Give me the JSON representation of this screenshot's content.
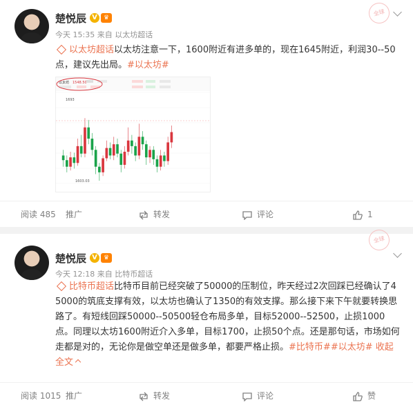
{
  "posts": [
    {
      "username": "楚悦辰",
      "meta": "今天 15:35 来自 以太坊超话",
      "stamp": "全球",
      "topic_tag": "以太坊超话",
      "text": "以太坊注意一下，1600附近有进多单的，现在1645附近，利润30--50点，建议先出局。",
      "hashtags": [
        "#以太坊#"
      ],
      "chart": {
        "header": {
          "symbol": "以太坊",
          "price": "1548.50"
        },
        "high_label": "1693",
        "low_label": "1603.03"
      },
      "actions": {
        "read": "阅读 485",
        "promote": "推广",
        "repost": "转发",
        "comment": "评论",
        "like": "1"
      }
    },
    {
      "username": "楚悦辰",
      "meta": "今天 12:18 来自 比特币超话",
      "stamp": "全球",
      "topic_tag": "比特币超话",
      "text": "比特币目前已经突破了50000的压制位，昨天经过2次回踩已经确认了45000的筑底支撑有效，以太坊也确认了1350的有效支撑。那么接下来下午就要转换思路了。有短线回踩50000--50500轻仓布局多单，目标52000--52500，止损1000点。同理以太坊1600附近介入多单，目标1700，止损50个点。还是那句话，市场如何走都是对的，无论你是做空单还是做多单，都要严格止损。",
      "hashtags": [
        "#比特币#",
        "#以太坊#"
      ],
      "collapse": "收起全文",
      "actions": {
        "read": "阅读 1015",
        "promote": "推广",
        "repost": "转发",
        "comment": "评论",
        "like": "赞"
      }
    }
  ],
  "chart_data": {
    "type": "candlestick",
    "candles": [
      [
        1630,
        1625,
        1636,
        1618
      ],
      [
        1625,
        1618,
        1630,
        1612
      ],
      [
        1618,
        1628,
        1634,
        1614
      ],
      [
        1628,
        1622,
        1633,
        1616
      ],
      [
        1622,
        1640,
        1648,
        1619
      ],
      [
        1640,
        1632,
        1652,
        1628
      ],
      [
        1632,
        1660,
        1670,
        1628
      ],
      [
        1660,
        1648,
        1668,
        1642
      ],
      [
        1648,
        1636,
        1654,
        1630
      ],
      [
        1636,
        1618,
        1640,
        1610
      ],
      [
        1618,
        1612,
        1622,
        1603
      ],
      [
        1612,
        1627,
        1630,
        1608
      ],
      [
        1627,
        1638,
        1646,
        1624
      ],
      [
        1638,
        1630,
        1644,
        1626
      ],
      [
        1630,
        1642,
        1650,
        1625
      ],
      [
        1642,
        1632,
        1648,
        1628
      ],
      [
        1632,
        1620,
        1636,
        1612
      ],
      [
        1620,
        1634,
        1640,
        1616
      ],
      [
        1634,
        1646,
        1660,
        1630
      ],
      [
        1646,
        1640,
        1652,
        1632
      ],
      [
        1640,
        1630,
        1644,
        1624
      ],
      [
        1630,
        1650,
        1664,
        1626
      ],
      [
        1650,
        1642,
        1656,
        1636
      ],
      [
        1642,
        1628,
        1646,
        1620
      ],
      [
        1628,
        1636,
        1640,
        1622
      ],
      [
        1636,
        1626,
        1640,
        1620
      ],
      [
        1626,
        1618,
        1630,
        1612
      ],
      [
        1618,
        1630,
        1636,
        1614
      ],
      [
        1630,
        1624,
        1634,
        1618
      ],
      [
        1624,
        1644,
        1650,
        1620
      ],
      [
        1644,
        1655,
        1662,
        1638
      ]
    ],
    "high": 1693,
    "low": 1603.03,
    "colors": {
      "up": "#d9363e",
      "down": "#1aa34a"
    }
  }
}
